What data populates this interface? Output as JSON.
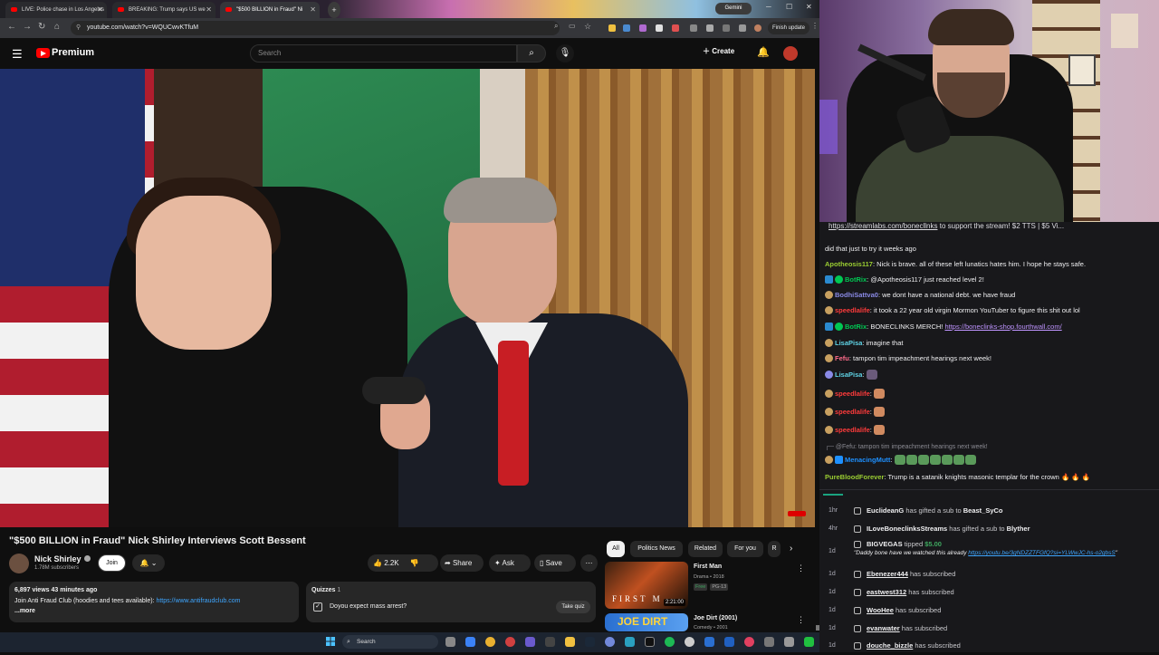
{
  "browser": {
    "tabs": [
      {
        "label": "LIVE: Police chase in Los Angeles"
      },
      {
        "label": "BREAKING: Trump says US we"
      },
      {
        "label": "\"$500 BILLION in Fraud\" Ni"
      }
    ],
    "gemini_label": "Gemini",
    "url": "youtube.com/watch?v=WQUCwvKTfuM",
    "finish_update_label": "Finish update"
  },
  "youtube": {
    "brand": "Premium",
    "search_placeholder": "Search",
    "create_label": "Create",
    "video": {
      "title": "\"$500 BILLION in Fraud\" Nick Shirley Interviews Scott Bessent",
      "channel_name": "Nick Shirley",
      "subscribers": "1.78M subscribers",
      "join_label": "Join",
      "likes": "2.2K",
      "share_label": "Share",
      "ask_label": "Ask",
      "save_label": "Save",
      "views_time": "6,897 views  43 minutes ago",
      "description_prefix": "Join Anti Fraud Club (hoodies and tees available): ",
      "description_link": "https://www.antifraudclub.com",
      "more_label": "...more"
    },
    "quiz": {
      "label": "Quizzes",
      "count": "1",
      "question": "Doyou expect mass arrest?",
      "take_label": "Take quiz"
    },
    "chips": [
      "All",
      "Politics News",
      "Related",
      "For you",
      "R"
    ],
    "recommended": [
      {
        "thumb_text": "FIRST M",
        "duration": "2:21:00",
        "title": "First Man",
        "meta": "Drama • 2018",
        "badge_free": "Free",
        "badge_rating": "PG-13"
      },
      {
        "thumb_text": "JOE DIRT",
        "title": "Joe Dirt (2001)",
        "meta": "Comedy • 2001"
      }
    ]
  },
  "taskbar": {
    "search_placeholder": "Search"
  },
  "chat": {
    "ticker_link": "https://streamlabs.com/bonecllnks",
    "ticker_text": " to support the stream! $2 TTS | $5 Vi...",
    "messages": [
      {
        "user": "",
        "text": "did that just to try it weeks ago",
        "color": "#efeff1"
      },
      {
        "user": "Apotheosis117",
        "text": " Nick is brave. all of these left lunatics hates him. I hope he stays safe.",
        "color": "#9acd32"
      },
      {
        "user": "BotRix",
        "text": " @Apotheosis117 just reached level 2!",
        "color": "#00c853"
      },
      {
        "user": "BodhiSattva0",
        "text": " we dont have a national debt. we have fraud",
        "color": "#8a8ae6"
      },
      {
        "user": "speedlalife",
        "text": " it took a 22 year old virgin Mormon YouTuber to figure this shit out lol",
        "color": "#ff3b3b"
      },
      {
        "user": "BotRix",
        "text": " BONECLINKS MERCH! ",
        "link": "https://boneclinks-shop.fourthwall.com/",
        "color": "#00c853"
      },
      {
        "user": "LisaPisa",
        "text": " imagine that",
        "color": "#5fd3e6"
      },
      {
        "user": "Fefu",
        "text": " tampon tim impeachment hearings next week!",
        "color": "#ff6b8a"
      },
      {
        "user": "LisaPisa",
        "text": "",
        "color": "#5fd3e6"
      },
      {
        "user": "speedlalife",
        "text": "",
        "color": "#ff3b3b"
      },
      {
        "user": "speedlalife",
        "text": "",
        "color": "#ff3b3b"
      },
      {
        "user": "speedlalife",
        "text": "",
        "color": "#ff3b3b"
      },
      {
        "user": "",
        "text": "@Fefu: tampon tim impeachment hearings next week!",
        "color": "#8a8a92"
      },
      {
        "user": "MenacingMutt",
        "text": "",
        "color": "#1e90ff"
      },
      {
        "user": "PureBloodForever",
        "text": " Trump is a satanik knights masonic templar for the crown 🔥 🔥 🔥",
        "color": "#9acd32"
      }
    ]
  },
  "events": [
    {
      "time": "1hr",
      "pre": "",
      "name": "EuclideanG",
      "mid": " has gifted a sub to ",
      "name2": "Beast_SyCo"
    },
    {
      "time": "4hr",
      "pre": "",
      "name": "ILoveBoneclinksStreams",
      "mid": " has gifted a sub to ",
      "name2": "Blyther"
    },
    {
      "time": "1d",
      "pre": "",
      "name": "BIGVEGAS",
      "mid": " tipped ",
      "amount": "$5.00",
      "sub_text": "\"Daddy bone have we watched this already ",
      "sub_link": "https://youtu.be/3gNDZZTFGfQ?si=YLWwJC-hs-o2gbsS",
      "sub_end": "\""
    },
    {
      "time": "1d",
      "name": "Ebenezer444",
      "mid": " has subscribed"
    },
    {
      "time": "1d",
      "name": "eastwest312",
      "mid": " has subscribed"
    },
    {
      "time": "1d",
      "name": "WooHee",
      "mid": " has subscribed"
    },
    {
      "time": "1d",
      "name": "evanwater",
      "mid": " has subscribed"
    },
    {
      "time": "1d",
      "name": "douche_bizzle",
      "mid": " has subscribed"
    }
  ],
  "colors": {
    "youtube_red": "#ff0000",
    "link_blue": "#3ea6ff",
    "chat_bg": "#18181b",
    "tip_green": "#3ea65f"
  }
}
